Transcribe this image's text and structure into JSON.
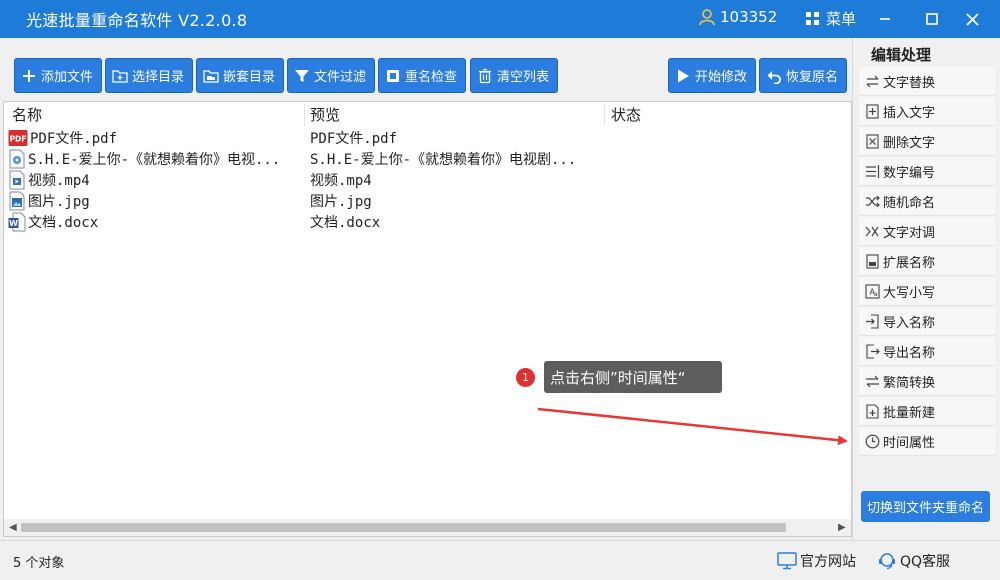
{
  "app": {
    "title": "光速批量重命名软件 V2.2.0.8",
    "user_id": "103352",
    "menu_label": "菜单"
  },
  "toolbar": {
    "buttons": [
      {
        "label": "添加文件",
        "icon": "plus-icon"
      },
      {
        "label": "选择目录",
        "icon": "folder-plus-icon"
      },
      {
        "label": "嵌套目录",
        "icon": "folder-nested-icon"
      },
      {
        "label": "文件过滤",
        "icon": "filter-icon"
      },
      {
        "label": "重名检查",
        "icon": "duplicate-check-icon"
      },
      {
        "label": "清空列表",
        "icon": "trash-icon"
      }
    ],
    "start_label": "开始修改",
    "restore_label": "恢复原名"
  },
  "file_list": {
    "columns": [
      "名称",
      "预览",
      "状态"
    ],
    "rows": [
      {
        "name": "PDF文件.pdf",
        "preview": "PDF文件.pdf",
        "icon": "pdf-icon"
      },
      {
        "name": "S.H.E-爱上你-《就想赖着你》电视...",
        "preview": "S.H.E-爱上你-《就想赖着你》电视剧...",
        "icon": "audio-file-icon"
      },
      {
        "name": "视频.mp4",
        "preview": "视频.mp4",
        "icon": "video-file-icon"
      },
      {
        "name": "图片.jpg",
        "preview": "图片.jpg",
        "icon": "image-file-icon"
      },
      {
        "name": "文档.docx",
        "preview": "文档.docx",
        "icon": "word-doc-icon"
      }
    ]
  },
  "right_panel": {
    "title": "编辑处理",
    "items": [
      {
        "label": "文字替换",
        "icon": "replace-icon"
      },
      {
        "label": "插入文字",
        "icon": "insert-text-icon"
      },
      {
        "label": "删除文字",
        "icon": "delete-text-icon"
      },
      {
        "label": "数字编号",
        "icon": "numbering-icon"
      },
      {
        "label": "随机命名",
        "icon": "shuffle-icon"
      },
      {
        "label": "文字对调",
        "icon": "swap-icon"
      },
      {
        "label": "扩展名称",
        "icon": "extension-icon"
      },
      {
        "label": "大写小写",
        "icon": "case-icon"
      },
      {
        "label": "导入名称",
        "icon": "import-icon"
      },
      {
        "label": "导出名称",
        "icon": "export-icon"
      },
      {
        "label": "繁简转换",
        "icon": "convert-icon"
      },
      {
        "label": "批量新建",
        "icon": "batch-new-icon"
      },
      {
        "label": "时间属性",
        "icon": "clock-icon"
      }
    ],
    "switch_label": "切换到文件夹重命名"
  },
  "status": {
    "count": "5 个对象",
    "website": "官方网站",
    "qq": "QQ客服"
  },
  "annotation": {
    "badge": "1",
    "text": "点击右侧”时间属性“"
  },
  "colors": {
    "titlebar": "#1f7bd8",
    "button": "#2b7de0",
    "annotation_bg": "#5d5d5d",
    "badge": "#e03030",
    "arrow": "#e53935"
  }
}
